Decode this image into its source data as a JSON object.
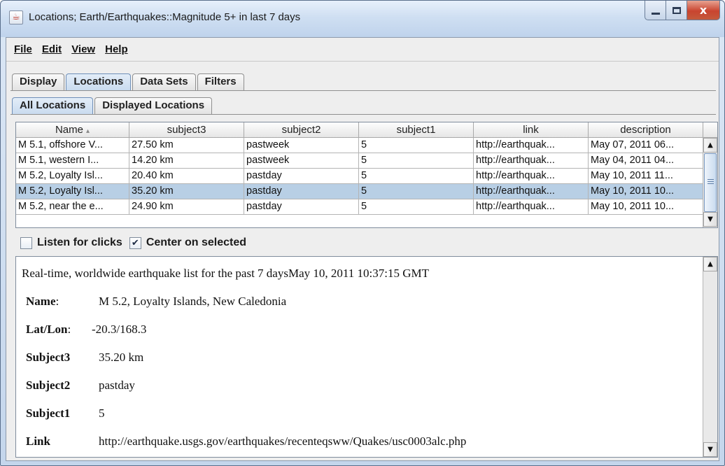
{
  "window": {
    "title": "Locations; Earth/Earthquakes::Magnitude 5+ in last 7 days",
    "app_icon_glyph": "☕",
    "close_glyph": "x"
  },
  "menu": [
    "File",
    "Edit",
    "View",
    "Help"
  ],
  "main_tabs": [
    {
      "label": "Display",
      "selected": false
    },
    {
      "label": "Locations",
      "selected": true
    },
    {
      "label": "Data Sets",
      "selected": false
    },
    {
      "label": "Filters",
      "selected": false
    }
  ],
  "sub_tabs": [
    {
      "label": "All Locations",
      "selected": true
    },
    {
      "label": "Displayed Locations",
      "selected": false
    }
  ],
  "table": {
    "columns": [
      "Name",
      "subject3",
      "subject2",
      "subject1",
      "link",
      "description"
    ],
    "sort_indicator": "▴",
    "rows": [
      [
        "M 5.1, offshore V...",
        "27.50 km",
        "pastweek",
        "5",
        "http://earthquak...",
        "May 07, 2011 06..."
      ],
      [
        "M 5.1, western I...",
        "14.20 km",
        "pastweek",
        "5",
        "http://earthquak...",
        "May 04, 2011 04..."
      ],
      [
        "M 5.2, Loyalty Isl...",
        "20.40 km",
        "pastday",
        "5",
        "http://earthquak...",
        "May 10, 2011 11..."
      ],
      [
        "M 5.2, Loyalty Isl...",
        "35.20 km",
        "pastday",
        "5",
        "http://earthquak...",
        "May 10, 2011 10..."
      ],
      [
        "M 5.2, near the e...",
        "24.90 km",
        "pastday",
        "5",
        "http://earthquak...",
        "May 10, 2011 10..."
      ]
    ],
    "selected_row": 3
  },
  "options": {
    "listen_label": "Listen for clicks",
    "listen_checked": false,
    "center_label": "Center on selected",
    "center_checked": true,
    "check_glyph": "✔"
  },
  "detail": {
    "headline": "Real-time, worldwide earthquake list for the past 7 daysMay 10, 2011 10:37:15 GMT",
    "fields": [
      {
        "label": "Name",
        "sep": ":",
        "value": "M 5.2, Loyalty Islands, New Caledonia"
      },
      {
        "label": "Lat/Lon",
        "sep": ":",
        "value": "-20.3/168.3"
      },
      {
        "label": "Subject3",
        "sep": "",
        "value": "35.20 km"
      },
      {
        "label": "Subject2",
        "sep": "",
        "value": "pastday"
      },
      {
        "label": "Subject1",
        "sep": "",
        "value": "5"
      },
      {
        "label": "Link",
        "sep": "",
        "value": "http://earthquake.usgs.gov/earthquakes/recenteqsww/Quakes/usc0003alc.php"
      }
    ]
  },
  "scroll_glyphs": {
    "up": "▲",
    "down": "▼"
  }
}
